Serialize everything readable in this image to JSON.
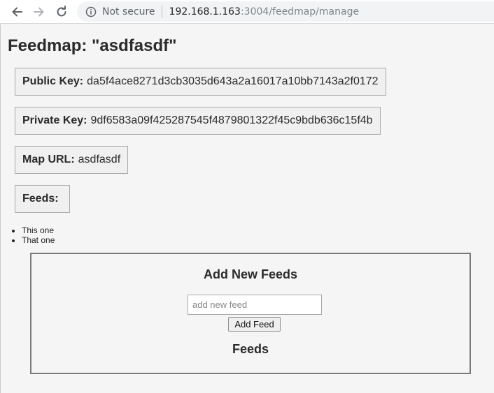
{
  "browser": {
    "security_label": "Not secure",
    "url_host": "192.168.1.163",
    "url_rest": ":3004/feedmap/manage"
  },
  "page": {
    "title": "Feedmap: \"asdfasdf\"",
    "public_key_label": "Public Key:",
    "public_key_value": "da5f4ace8271d3cb3035d643a2a16017a10bb7143a2f0172",
    "private_key_label": "Private Key:",
    "private_key_value": "9df6583a09f425287545f4879801322f45c9bdb636c15f4b",
    "map_url_label": "Map URL:",
    "map_url_value": "asdfasdf",
    "feeds_label": "Feeds:",
    "feeds": [
      "This one",
      "That one"
    ]
  },
  "add_panel": {
    "heading": "Add New Feeds",
    "input_placeholder": "add new feed",
    "input_value": "",
    "button_label": "Add Feed",
    "feeds_heading": "Feeds"
  }
}
